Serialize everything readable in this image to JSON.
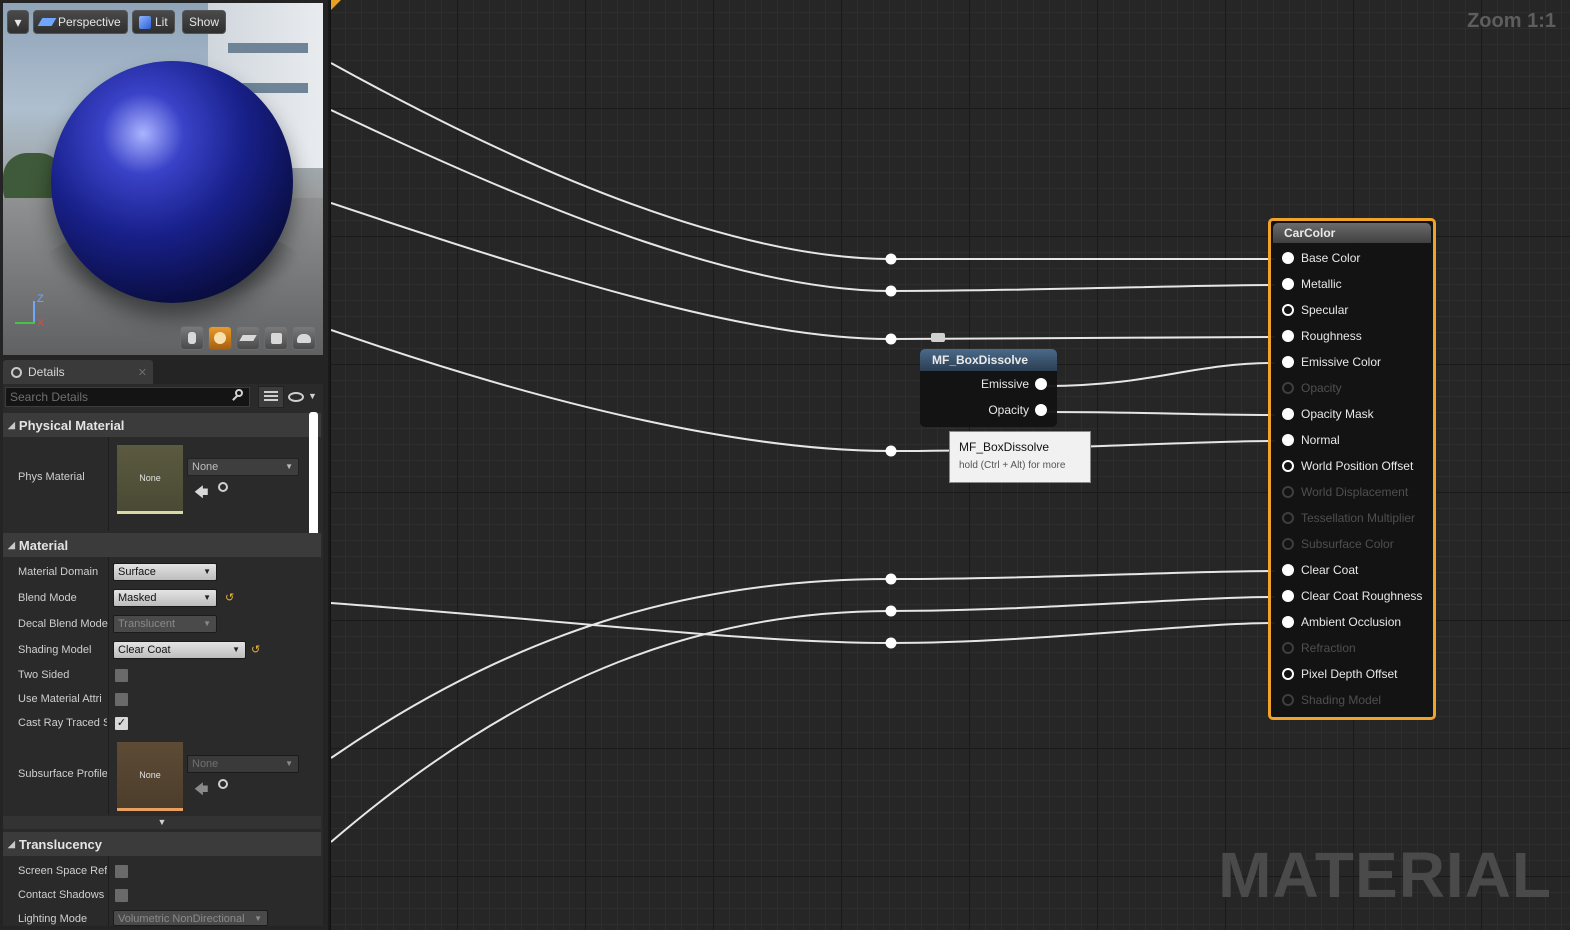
{
  "viewport": {
    "menu_arrow": "▾",
    "perspective_label": "Perspective",
    "lit_label": "Lit",
    "show_label": "Show",
    "axis_z": "Z",
    "axis_x": "X",
    "preview_shapes": [
      "cylinder-icon",
      "sphere-icon",
      "plane-icon",
      "cube-icon",
      "custom-mesh-icon"
    ],
    "active_shape": "sphere-icon",
    "material_color": "#1a2196"
  },
  "details": {
    "tab_label": "Details",
    "search_placeholder": "Search Details",
    "sections": {
      "physical_material": "Physical Material",
      "material": "Material",
      "translucency": "Translucency"
    },
    "phys_material": {
      "label": "Phys Material",
      "thumb": "None",
      "value": "None"
    },
    "props": {
      "material_domain": {
        "label": "Material Domain",
        "value": "Surface"
      },
      "blend_mode": {
        "label": "Blend Mode",
        "value": "Masked"
      },
      "decal_blend_mode": {
        "label": "Decal Blend Mode",
        "value": "Translucent"
      },
      "shading_model": {
        "label": "Shading Model",
        "value": "Clear Coat"
      },
      "two_sided": {
        "label": "Two Sided",
        "checked": false
      },
      "use_material_attri": {
        "label": "Use Material Attri",
        "checked": false
      },
      "cast_ray_traced": {
        "label": "Cast Ray Traced S",
        "checked": true
      },
      "subsurface_profile": {
        "label": "Subsurface Profile",
        "thumb": "None",
        "value": "None"
      },
      "screen_space_ref": {
        "label": "Screen Space Ref",
        "checked": false
      },
      "contact_shadows": {
        "label": "Contact Shadows",
        "checked": false
      },
      "lighting_mode": {
        "label": "Lighting Mode",
        "value": "Volumetric NonDirectional"
      }
    }
  },
  "graph": {
    "zoom_label": "Zoom 1:1",
    "watermark": "MATERIAL",
    "function_node": {
      "title": "MF_BoxDissolve",
      "outputs": [
        "Emissive",
        "Opacity"
      ]
    },
    "tooltip": {
      "title": "MF_BoxDissolve",
      "hint": "hold (Ctrl + Alt) for more"
    },
    "result_node": {
      "title": "CarColor",
      "pins": [
        {
          "label": "Base Color",
          "state": "connected"
        },
        {
          "label": "Metallic",
          "state": "connected"
        },
        {
          "label": "Specular",
          "state": "open"
        },
        {
          "label": "Roughness",
          "state": "connected"
        },
        {
          "label": "Emissive Color",
          "state": "connected"
        },
        {
          "label": "Opacity",
          "state": "disabled"
        },
        {
          "label": "Opacity Mask",
          "state": "connected"
        },
        {
          "label": "Normal",
          "state": "connected"
        },
        {
          "label": "World Position Offset",
          "state": "open"
        },
        {
          "label": "World Displacement",
          "state": "disabled"
        },
        {
          "label": "Tessellation Multiplier",
          "state": "disabled"
        },
        {
          "label": "Subsurface Color",
          "state": "disabled"
        },
        {
          "label": "Clear Coat",
          "state": "connected"
        },
        {
          "label": "Clear Coat Roughness",
          "state": "connected"
        },
        {
          "label": "Ambient Occlusion",
          "state": "connected"
        },
        {
          "label": "Refraction",
          "state": "disabled"
        },
        {
          "label": "Pixel Depth Offset",
          "state": "open"
        },
        {
          "label": "Shading Model",
          "state": "disabled"
        }
      ]
    },
    "colors": {
      "node_border": "#f0a22a",
      "wire": "#e6e6e6"
    }
  }
}
